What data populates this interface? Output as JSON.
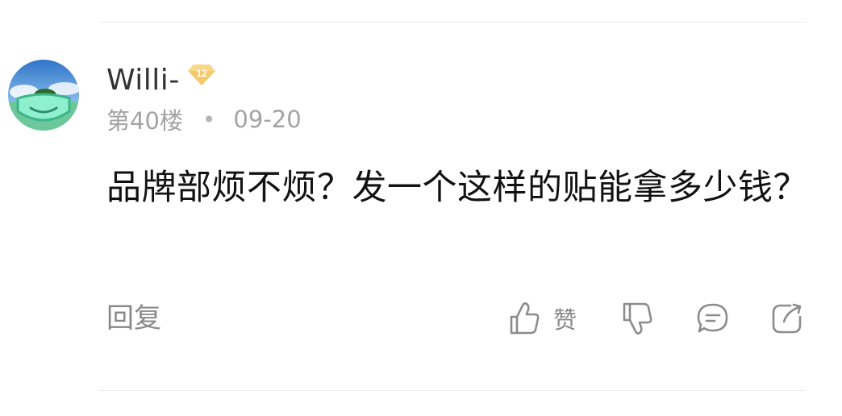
{
  "comment": {
    "username": "Willi-",
    "level": "12",
    "floor": "第40楼",
    "separator": "•",
    "date": "09-20",
    "text": "品牌部烦不烦？发一个这样的贴能拿多少钱？"
  },
  "actions": {
    "reply_label": "回复",
    "like_label": "赞",
    "like_icon": "thumbs-up-icon",
    "dislike_icon": "thumbs-down-icon",
    "comment_icon": "comment-bubble-icon",
    "share_icon": "share-icon"
  },
  "colors": {
    "badge": "#f5c96b",
    "meta_text": "#a3a3a3",
    "action_text": "#888888",
    "icon_stroke": "#8c8c8c"
  }
}
